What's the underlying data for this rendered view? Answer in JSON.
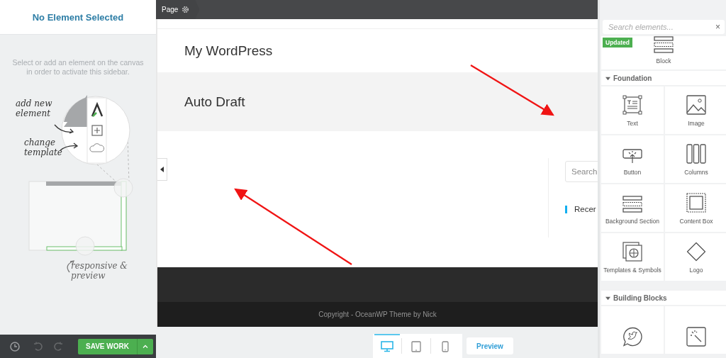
{
  "left_sidebar": {
    "title": "No Element Selected",
    "hint": "Select or add an element on the canvas in order to activate this sidebar.",
    "illustration": {
      "labels": [
        "add new element",
        "change template",
        "responsive & preview"
      ]
    },
    "save_button": "SAVE WORK"
  },
  "canvas": {
    "breadcrumb": "Page",
    "site_title": "My WordPress",
    "page_title": "Auto Draft",
    "search": {
      "placeholder": "Search"
    },
    "widget_heading": "Recer",
    "copyright": "Copyright - OceanWP Theme by Nick"
  },
  "device_tabs": [
    {
      "kind": "desktop",
      "selected": true
    },
    {
      "kind": "tablet",
      "selected": false
    },
    {
      "kind": "mobile",
      "selected": false
    }
  ],
  "preview_button": "Preview",
  "elements_panel": {
    "search": {
      "placeholder": "Search elements..."
    },
    "close": "×",
    "featured": {
      "badge": "Updated",
      "label": "Block",
      "kind": "block"
    },
    "sections": [
      {
        "title": "Foundation",
        "expanded": true,
        "items": [
          {
            "kind": "text",
            "label": "Text"
          },
          {
            "kind": "image",
            "label": "Image"
          },
          {
            "kind": "button",
            "label": "Button"
          },
          {
            "kind": "columns",
            "label": "Columns"
          },
          {
            "kind": "block",
            "label": "Background Section"
          },
          {
            "kind": "box",
            "label": "Content Box"
          },
          {
            "kind": "templates",
            "label": "Templates & Symbols"
          },
          {
            "kind": "logo",
            "label": "Logo"
          }
        ]
      },
      {
        "title": "Building Blocks",
        "expanded": true,
        "items": [
          {
            "kind": "tweet"
          },
          {
            "kind": "reveal"
          }
        ]
      }
    ]
  }
}
